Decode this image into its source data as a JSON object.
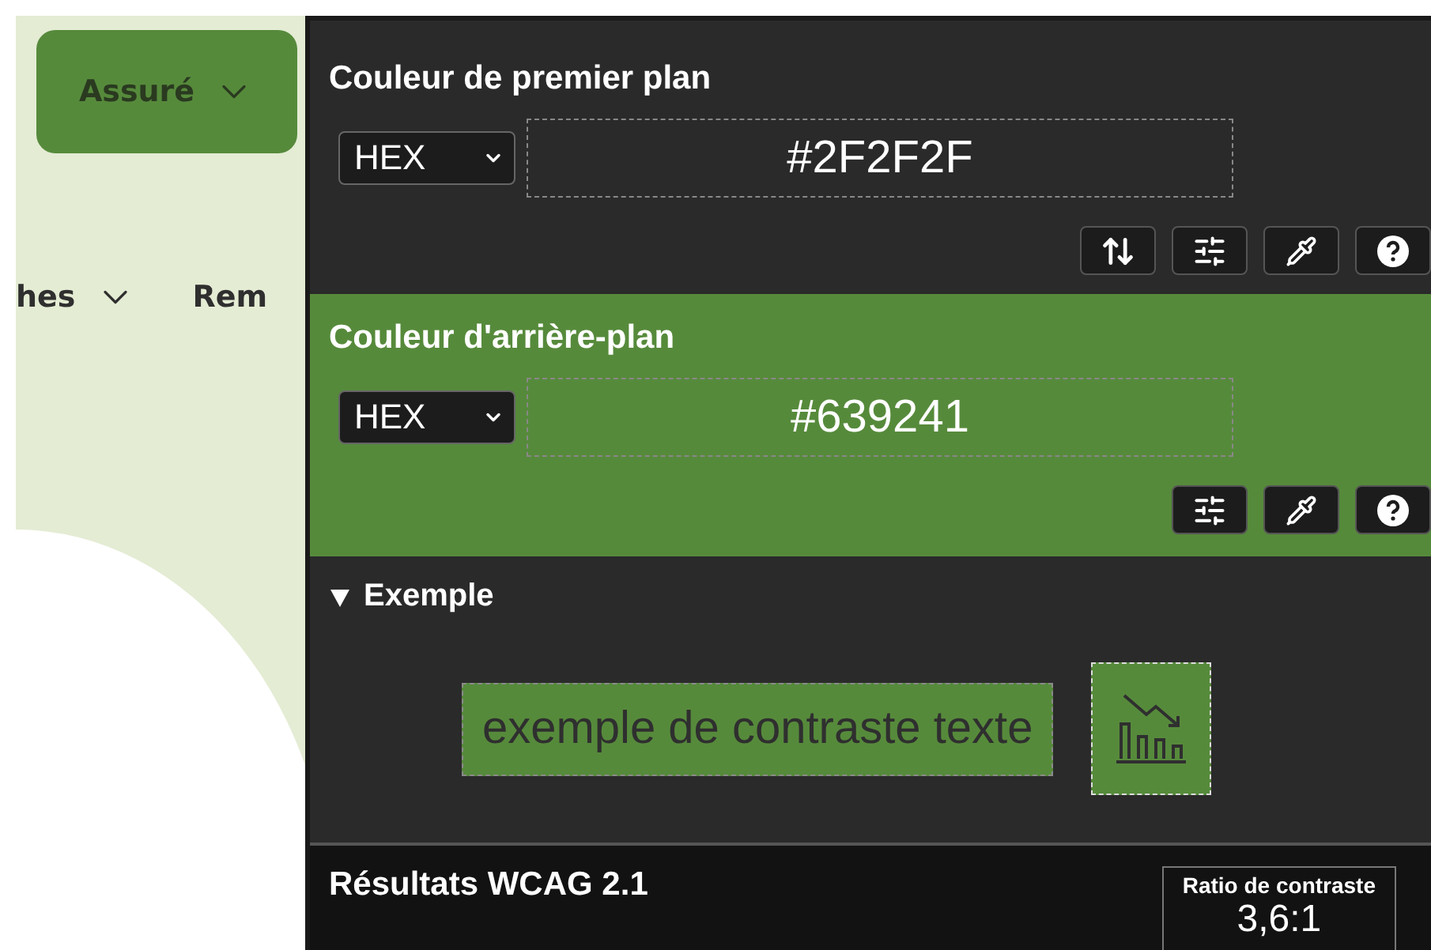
{
  "page": {
    "account_button": {
      "label": "Assuré"
    },
    "nav_items": [
      {
        "label": "hes",
        "has_menu": true
      },
      {
        "label": "Rem",
        "has_menu": false
      }
    ]
  },
  "panel": {
    "foreground": {
      "title": "Couleur de premier plan",
      "format": "HEX",
      "value": "#2F2F2F",
      "tools": [
        {
          "kind": "swap"
        },
        {
          "kind": "sliders"
        },
        {
          "kind": "eyedropper"
        },
        {
          "kind": "help"
        }
      ]
    },
    "background": {
      "title": "Couleur d'arrière-plan",
      "format": "HEX",
      "value": "#639241",
      "tools": [
        {
          "kind": "sliders"
        },
        {
          "kind": "eyedropper"
        },
        {
          "kind": "help"
        }
      ]
    },
    "example": {
      "label": "Exemple",
      "expanded": true,
      "sample_text": "exemple de contraste texte"
    },
    "results": {
      "title": "Résultats WCAG 2.1",
      "ratio_label": "Ratio de contraste",
      "ratio": "3,6:1"
    }
  }
}
